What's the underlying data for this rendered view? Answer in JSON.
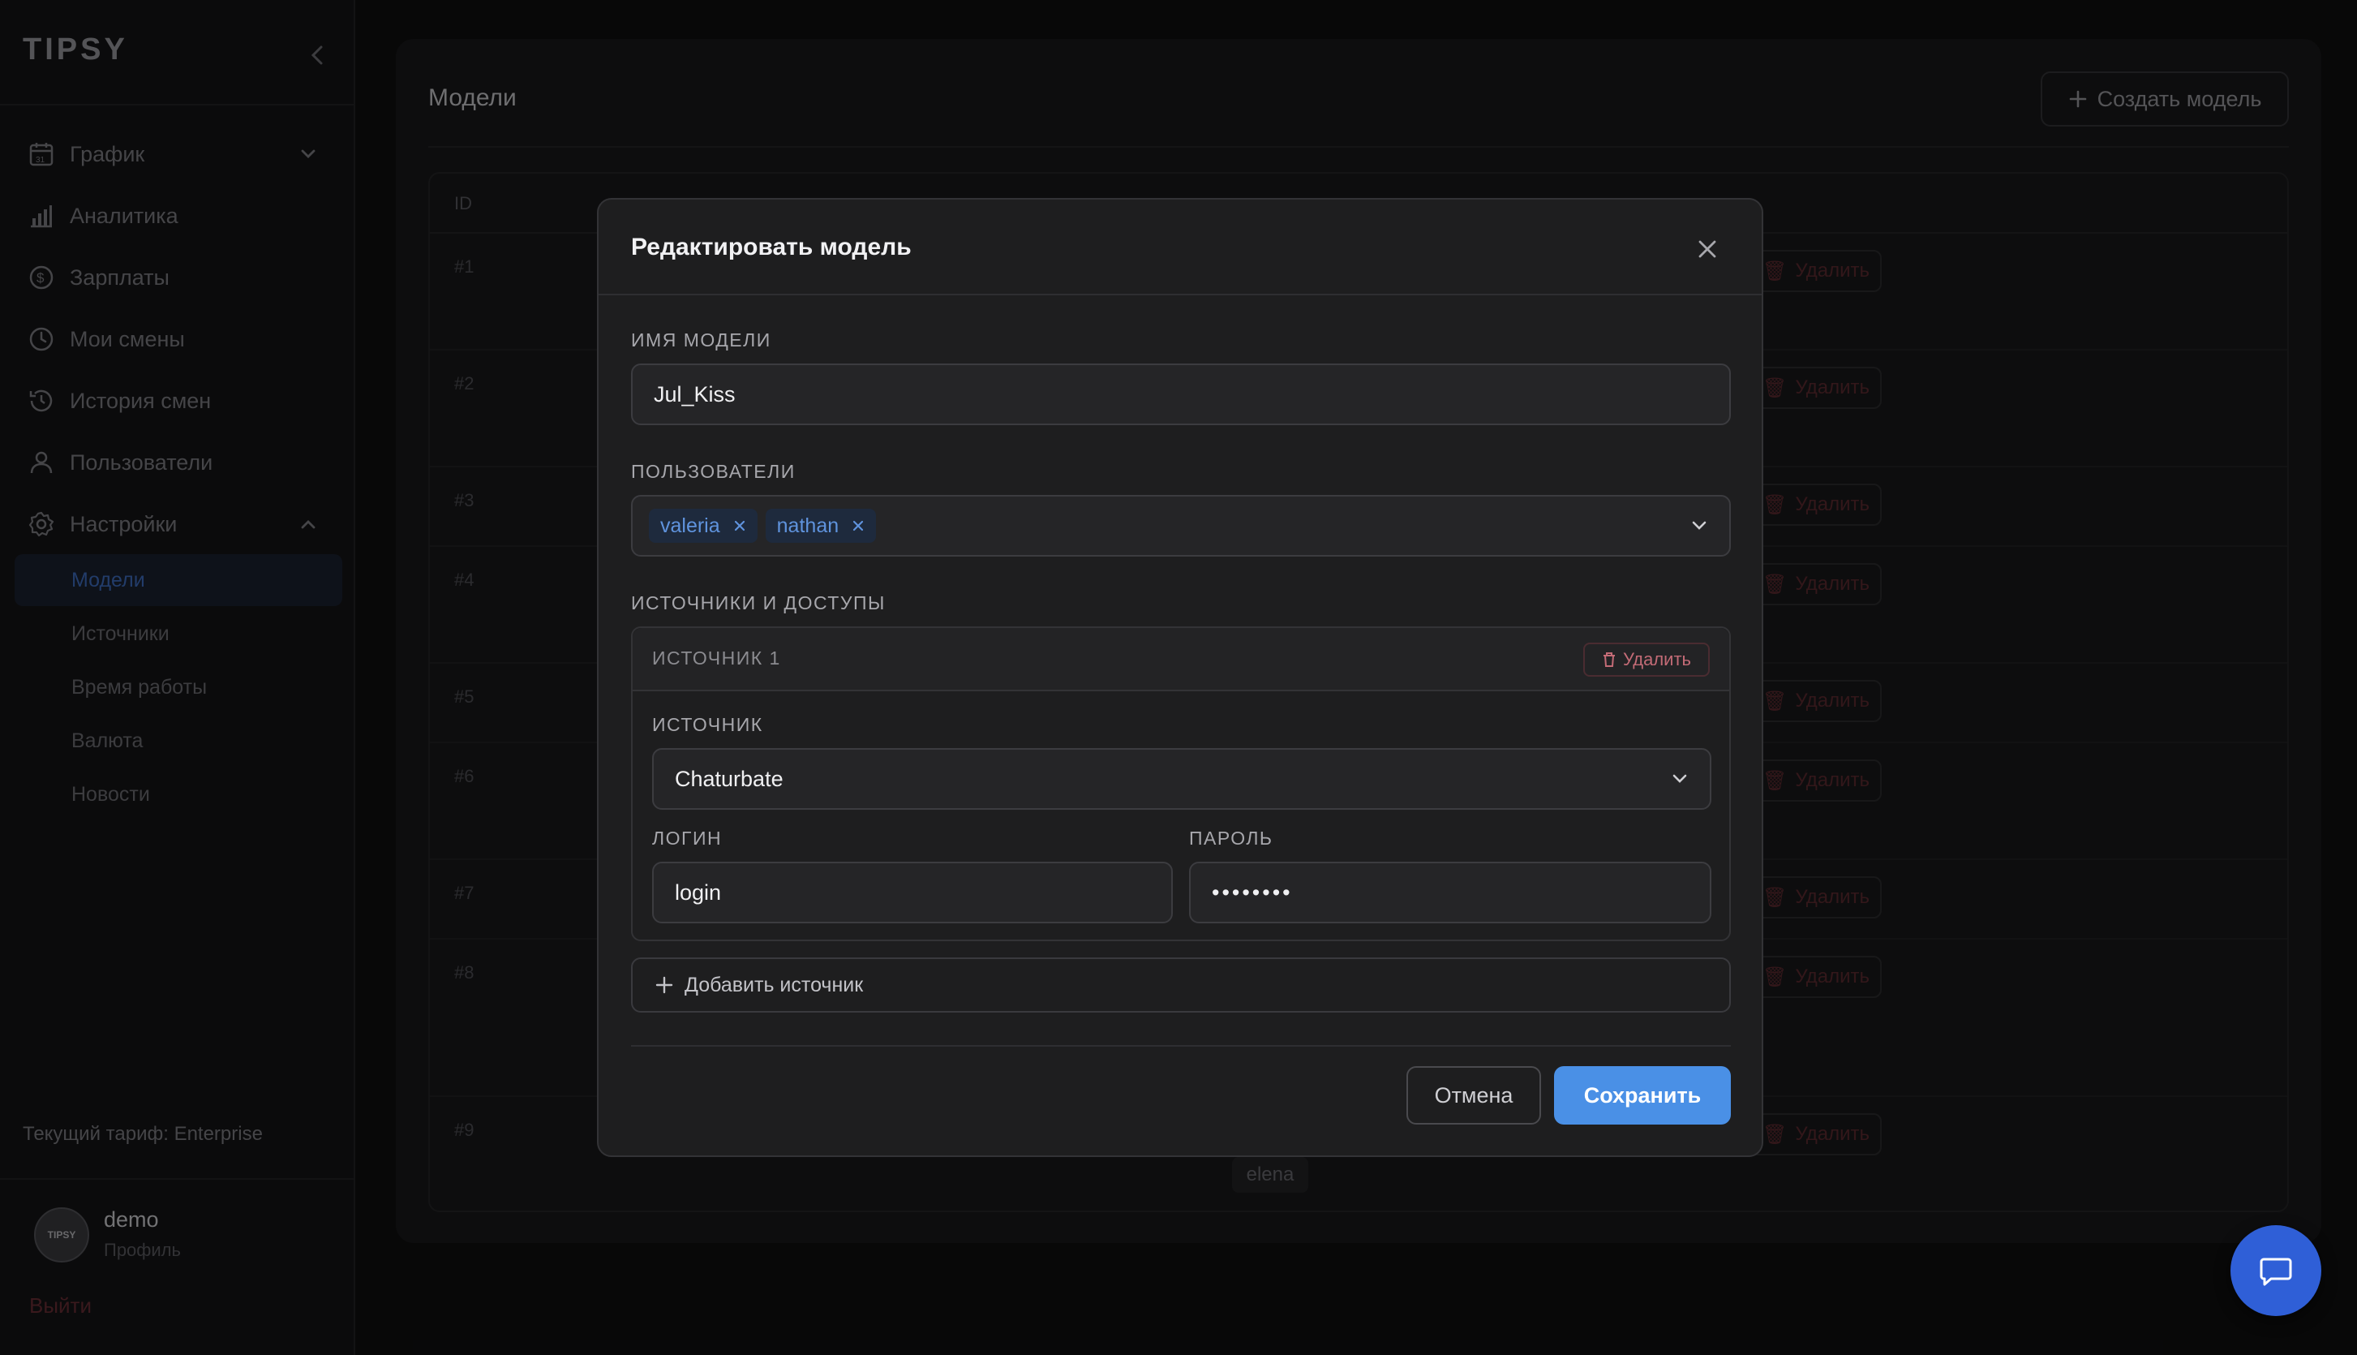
{
  "sidebar": {
    "brand": "TIPSY",
    "nav": [
      {
        "label": "График",
        "icon": "calendar-icon"
      },
      {
        "label": "Аналитика",
        "icon": "bar-chart-icon"
      },
      {
        "label": "Зарплаты",
        "icon": "dollar-icon"
      },
      {
        "label": "Мои смены",
        "icon": "clock-icon"
      },
      {
        "label": "История смен",
        "icon": "history-icon"
      },
      {
        "label": "Пользователи",
        "icon": "user-icon"
      },
      {
        "label": "Настройки",
        "icon": "gear-icon"
      }
    ],
    "settings_sub": [
      {
        "label": "Модели",
        "active": true
      },
      {
        "label": "Источники"
      },
      {
        "label": "Время работы"
      },
      {
        "label": "Валюта"
      },
      {
        "label": "Новости"
      }
    ],
    "plan": "Текущий тариф: Enterprise",
    "user": {
      "avatar_text": "TIPSY",
      "name": "demo",
      "sub": "Профиль"
    },
    "logout": "Выйти"
  },
  "main": {
    "title": "Модели",
    "create_button": "Создать модель",
    "table": {
      "id_header": "ID",
      "rows": [
        {
          "id": "#1",
          "delete": "Удалить"
        },
        {
          "id": "#2",
          "delete": "Удалить"
        },
        {
          "id": "#3",
          "delete": "Удалить"
        },
        {
          "id": "#4",
          "delete": "Удалить"
        },
        {
          "id": "#5",
          "delete": "Удалить"
        },
        {
          "id": "#6",
          "delete": "Удалить"
        },
        {
          "id": "#7",
          "delete": "Удалить"
        },
        {
          "id": "#8",
          "delete": "Удалить"
        },
        {
          "id": "#9",
          "delete": "Удалить"
        }
      ],
      "visible_user_chip": "elena"
    }
  },
  "modal": {
    "title": "Редактировать модель",
    "model_name_label": "Имя модели",
    "model_name_value": "Jul_Kiss",
    "users_label": "Пользователи",
    "users": [
      "valeria",
      "nathan"
    ],
    "sources_label": "Источники и доступы",
    "source": {
      "title": "ИСТОЧНИК 1",
      "delete": "Удалить",
      "source_label": "Источник",
      "source_value": "Chaturbate",
      "login_label": "Логин",
      "login_value": "login",
      "password_label": "Пароль",
      "password_value": "••••••••"
    },
    "add_source": "Добавить источник",
    "cancel": "Отмена",
    "save": "Сохранить"
  },
  "colors": {
    "accent": "#4a90e6",
    "chat": "#2f5fd7",
    "danger": "#c36b76",
    "active_nav": "#3e6ec2"
  }
}
